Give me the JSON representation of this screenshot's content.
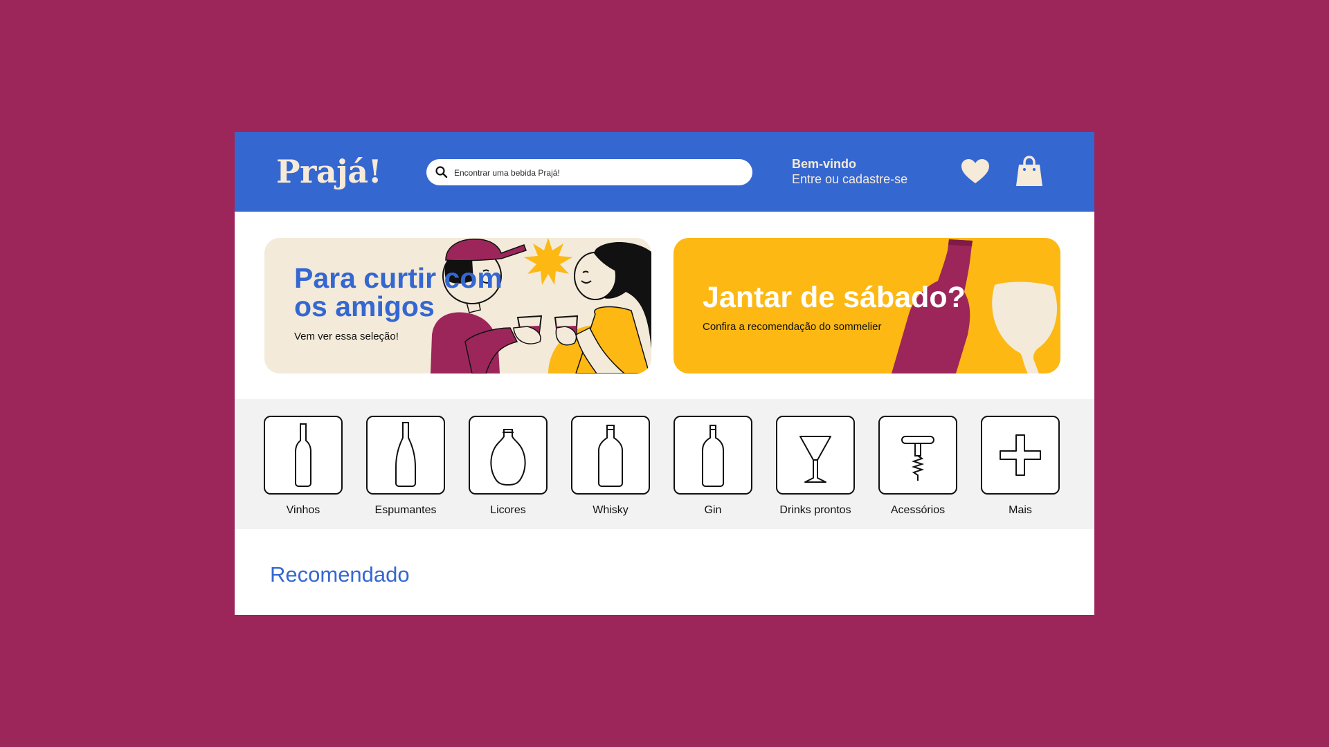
{
  "header": {
    "logo": "Prajá!",
    "search_placeholder": "Encontrar uma bebida Prajá!",
    "welcome": "Bem-vindo",
    "login": "Entre ou cadastre-se",
    "icons": [
      "search-icon",
      "heart-icon",
      "shopping-bag-icon"
    ]
  },
  "banners": [
    {
      "title": "Para curtir com os amigos",
      "subtitle": "Vem ver essa seleção!"
    },
    {
      "title": "Jantar de sábado?",
      "subtitle": "Confira a recomendação do sommelier"
    }
  ],
  "categories": [
    {
      "label": "Vinhos",
      "icon": "wine-bottle-icon"
    },
    {
      "label": "Espumantes",
      "icon": "sparkling-bottle-icon"
    },
    {
      "label": "Licores",
      "icon": "liqueur-flask-icon"
    },
    {
      "label": "Whisky",
      "icon": "whisky-bottle-icon"
    },
    {
      "label": "Gin",
      "icon": "gin-bottle-icon"
    },
    {
      "label": "Drinks prontos",
      "icon": "cocktail-glass-icon"
    },
    {
      "label": "Acessórios",
      "icon": "corkscrew-icon"
    },
    {
      "label": "Mais",
      "icon": "plus-icon"
    }
  ],
  "section": {
    "title": "Recomendado"
  },
  "colors": {
    "background": "#9C265A",
    "header": "#3567D1",
    "cream": "#F3EAD9",
    "yellow": "#FDB814",
    "wine": "#9C265A"
  }
}
